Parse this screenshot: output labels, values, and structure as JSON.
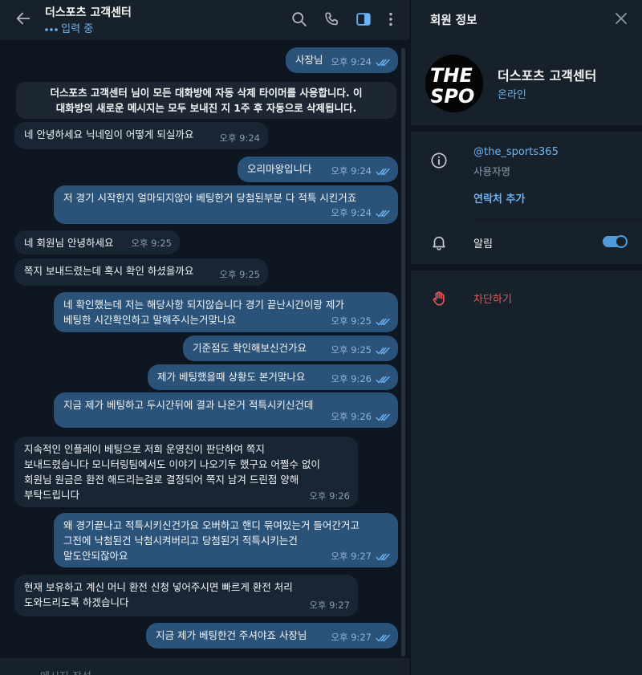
{
  "chat": {
    "title": "더스포츠 고객센터",
    "status": "입력 중",
    "composer_placeholder": "메시지 작성",
    "service_message": {
      "line1": "더스포츠 고객센터 님이 모든 대화방에 자동 삭제 타이머를 사용합니다. 이",
      "line2": "대화방의 새로운 메시지는 모두 보내진 지 1주 후 자동으로 삭제됩니다."
    },
    "messages": [
      {
        "lines": [
          "사장님"
        ],
        "time": "오후 9:24"
      },
      {
        "lines": [
          "네 안녕하세요 닉네임이 어떻게 되실까요"
        ],
        "time": "오후 9:24"
      },
      {
        "lines": [
          "오리마왕입니다"
        ],
        "time": "오후 9:24"
      },
      {
        "lines": [
          "저 경기 시작한지 얼마되지않아 베팅한거 당첨된부분 다 적특 시킨거죠"
        ],
        "time": "오후 9:24"
      },
      {
        "lines": [
          "네 회원님 안녕하세요"
        ],
        "time": "오후 9:25"
      },
      {
        "lines": [
          "쪽지 보내드렸는데 혹시 확인 하셨을까요"
        ],
        "time": "오후 9:25"
      },
      {
        "lines": [
          "네 확인했는데 저는 해당사항 되지않습니다 경기 끝난시간이랑 제가",
          "베팅한 시간확인하고 말해주시는거맞나요"
        ],
        "time": "오후 9:25"
      },
      {
        "lines": [
          "기준점도 확인해보신건가요"
        ],
        "time": "오후 9:25"
      },
      {
        "lines": [
          "제가 베팅했을때 상황도 본거맞나요"
        ],
        "time": "오후 9:26"
      },
      {
        "lines": [
          "지금 제가 베팅하고 두시간뒤에 결과 나온거 적특시키신건데"
        ],
        "time": "오후 9:26"
      },
      {
        "lines": [
          "지속적인 인플레이 베팅으로 저희 운영진이 판단하여 쪽지",
          "보내드렸습니다 모니터링팀에서도 이야기 나오기두 했구요 어쩔수 없이",
          "회원님 원금은 환전 해드리는걸로 결정되어 쪽지 남겨 드린점 양해",
          "부탁드립니다"
        ],
        "time": "오후 9:26"
      },
      {
        "lines": [
          "왜 경기끝나고 적특시키신건가요 오버하고 핸디 묶여있는거 들어간거고",
          "그전에 낙첨된건 낙첨시켜버리고 당첨된거 적특시키는건",
          "말도안되잖아요"
        ],
        "time": "오후 9:27"
      },
      {
        "lines": [
          "현재 보유하고 계신 머니 환전 신청 넣어주시면 빠르게 환전 처리",
          "도와드리도록 하겠습니다"
        ],
        "time": "오후 9:27"
      },
      {
        "lines": [
          "지금 제가 베팅한건 주셔야죠 사장님"
        ],
        "time": "오후 9:27"
      }
    ]
  },
  "panel": {
    "title": "회원 정보",
    "avatar_text": {
      "line1": "THE",
      "line2": "SPO"
    },
    "name": "더스포츠 고객센터",
    "status": "온라인",
    "username": "@the_sports365",
    "username_label": "사용자명",
    "add_contact": "연락처 추가",
    "notifications_label": "알림",
    "notifications_on": true,
    "block_label": "차단하기"
  },
  "icons": {
    "back": "arrow-left-icon",
    "search": "search-icon",
    "call": "phone-icon",
    "sidebar": "sidebar-toggle-icon",
    "more": "more-vertical-icon",
    "close": "close-icon",
    "info": "info-icon",
    "bell": "bell-icon",
    "block": "hand-block-icon"
  },
  "colors": {
    "chat_background": "#0e1621",
    "panel_background": "#17212b",
    "incoming_bubble": "#182533",
    "outgoing_bubble": "#2b5278",
    "accent": "#6ab3f3",
    "danger": "#ec5858"
  }
}
